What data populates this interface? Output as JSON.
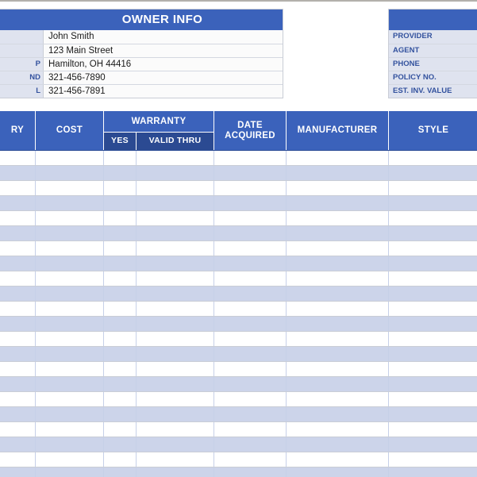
{
  "owner_info": {
    "title": "OWNER INFO",
    "rows": [
      {
        "label": "",
        "value": "John Smith"
      },
      {
        "label": "",
        "value": "123 Main Street"
      },
      {
        "label": "P",
        "value": "Hamilton, OH  44416"
      },
      {
        "label": "ND",
        "value": "321-456-7890"
      },
      {
        "label": "L",
        "value": "321-456-7891"
      }
    ]
  },
  "insurance_info": {
    "title": "",
    "rows": [
      {
        "label": "PROVIDER"
      },
      {
        "label": "AGENT"
      },
      {
        "label": "PHONE"
      },
      {
        "label": "POLICY NO."
      },
      {
        "label": "EST. INV. VALUE"
      }
    ]
  },
  "table": {
    "columns": [
      {
        "label": "RY",
        "key": "category"
      },
      {
        "label": "COST",
        "key": "cost"
      },
      {
        "label": "WARRANTY",
        "key": "warranty",
        "subcolumns": [
          {
            "label": "YES",
            "key": "warranty_yes"
          },
          {
            "label": "VALID THRU",
            "key": "warranty_valid_thru"
          }
        ]
      },
      {
        "label": "DATE ACQUIRED",
        "key": "date_acquired"
      },
      {
        "label": "MANUFACTURER",
        "key": "manufacturer"
      },
      {
        "label": "STYLE",
        "key": "style"
      }
    ],
    "rows": [
      {
        "category": "",
        "cost": "",
        "warranty_yes": "",
        "warranty_valid_thru": "",
        "date_acquired": "",
        "manufacturer": "",
        "style": ""
      },
      {
        "category": "",
        "cost": "",
        "warranty_yes": "",
        "warranty_valid_thru": "",
        "date_acquired": "",
        "manufacturer": "",
        "style": ""
      },
      {
        "category": "",
        "cost": "",
        "warranty_yes": "",
        "warranty_valid_thru": "",
        "date_acquired": "",
        "manufacturer": "",
        "style": ""
      },
      {
        "category": "",
        "cost": "",
        "warranty_yes": "",
        "warranty_valid_thru": "",
        "date_acquired": "",
        "manufacturer": "",
        "style": ""
      },
      {
        "category": "",
        "cost": "",
        "warranty_yes": "",
        "warranty_valid_thru": "",
        "date_acquired": "",
        "manufacturer": "",
        "style": ""
      },
      {
        "category": "",
        "cost": "",
        "warranty_yes": "",
        "warranty_valid_thru": "",
        "date_acquired": "",
        "manufacturer": "",
        "style": ""
      },
      {
        "category": "",
        "cost": "",
        "warranty_yes": "",
        "warranty_valid_thru": "",
        "date_acquired": "",
        "manufacturer": "",
        "style": ""
      },
      {
        "category": "",
        "cost": "",
        "warranty_yes": "",
        "warranty_valid_thru": "",
        "date_acquired": "",
        "manufacturer": "",
        "style": ""
      },
      {
        "category": "",
        "cost": "",
        "warranty_yes": "",
        "warranty_valid_thru": "",
        "date_acquired": "",
        "manufacturer": "",
        "style": ""
      },
      {
        "category": "",
        "cost": "",
        "warranty_yes": "",
        "warranty_valid_thru": "",
        "date_acquired": "",
        "manufacturer": "",
        "style": ""
      },
      {
        "category": "",
        "cost": "",
        "warranty_yes": "",
        "warranty_valid_thru": "",
        "date_acquired": "",
        "manufacturer": "",
        "style": ""
      },
      {
        "category": "",
        "cost": "",
        "warranty_yes": "",
        "warranty_valid_thru": "",
        "date_acquired": "",
        "manufacturer": "",
        "style": ""
      },
      {
        "category": "",
        "cost": "",
        "warranty_yes": "",
        "warranty_valid_thru": "",
        "date_acquired": "",
        "manufacturer": "",
        "style": ""
      },
      {
        "category": "",
        "cost": "",
        "warranty_yes": "",
        "warranty_valid_thru": "",
        "date_acquired": "",
        "manufacturer": "",
        "style": ""
      },
      {
        "category": "",
        "cost": "",
        "warranty_yes": "",
        "warranty_valid_thru": "",
        "date_acquired": "",
        "manufacturer": "",
        "style": ""
      },
      {
        "category": "",
        "cost": "",
        "warranty_yes": "",
        "warranty_valid_thru": "",
        "date_acquired": "",
        "manufacturer": "",
        "style": ""
      },
      {
        "category": "",
        "cost": "",
        "warranty_yes": "",
        "warranty_valid_thru": "",
        "date_acquired": "",
        "manufacturer": "",
        "style": ""
      },
      {
        "category": "",
        "cost": "",
        "warranty_yes": "",
        "warranty_valid_thru": "",
        "date_acquired": "",
        "manufacturer": "",
        "style": ""
      },
      {
        "category": "",
        "cost": "",
        "warranty_yes": "",
        "warranty_valid_thru": "",
        "date_acquired": "",
        "manufacturer": "",
        "style": ""
      },
      {
        "category": "",
        "cost": "",
        "warranty_yes": "",
        "warranty_valid_thru": "",
        "date_acquired": "",
        "manufacturer": "",
        "style": ""
      },
      {
        "category": "",
        "cost": "",
        "warranty_yes": "",
        "warranty_valid_thru": "",
        "date_acquired": "",
        "manufacturer": "",
        "style": ""
      },
      {
        "category": "",
        "cost": "",
        "warranty_yes": "",
        "warranty_valid_thru": "",
        "date_acquired": "",
        "manufacturer": "",
        "style": ""
      }
    ]
  },
  "colors": {
    "header_blue": "#3b62bb",
    "subheader_blue": "#2b4a92",
    "stripe_blue": "#ccd4ea",
    "label_fill": "#dfe3ef",
    "label_text": "#33529e",
    "gridline": "#c9cdd6"
  }
}
